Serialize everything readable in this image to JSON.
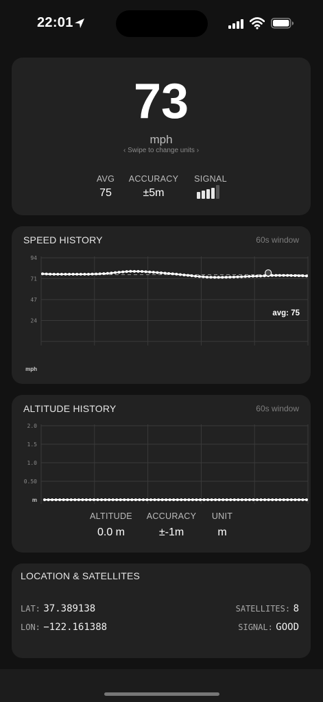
{
  "status_bar": {
    "time": "22:01"
  },
  "speed": {
    "value": "73",
    "unit": "mph",
    "hint": "‹  Swipe to change units  ›",
    "stats": [
      {
        "label": "AVG",
        "value": "75"
      },
      {
        "label": "ACCURACY",
        "value": "±5m"
      },
      {
        "label": "SIGNAL",
        "value": ""
      }
    ],
    "signal_strength": 4,
    "signal_max": 5
  },
  "speed_history": {
    "title": "SPEED HISTORY",
    "window": "60s window",
    "avg_label": "avg: 75"
  },
  "altitude_history": {
    "title": "ALTITUDE HISTORY",
    "window": "60s window",
    "stats": [
      {
        "label": "ALTITUDE",
        "value": "0.0 m"
      },
      {
        "label": "ACCURACY",
        "value": "±-1m"
      },
      {
        "label": "UNIT",
        "value": "m"
      }
    ]
  },
  "location": {
    "title": "LOCATION & SATELLITES",
    "lat_label": "LAT:",
    "lat_value": "37.389138",
    "lon_label": "LON:",
    "lon_value": "−122.161388",
    "satellites_label": "SATELLITES:",
    "satellites_value": "8",
    "signal_label": "SIGNAL:",
    "signal_value": "GOOD"
  },
  "chart_data": [
    {
      "type": "line",
      "ylabel": "mph",
      "yticks": [
        "94",
        "71",
        "47",
        "24"
      ],
      "ylim": [
        0,
        94
      ],
      "avg": 75,
      "x": [
        0,
        60
      ],
      "series": [
        {
          "values": [
            76,
            75.5,
            75.5,
            75.5,
            75.5,
            75.8,
            76.5,
            77.8,
            78.8,
            78.6,
            77.8,
            76.8,
            75.8,
            74.5,
            73.2,
            72.2,
            72,
            72.2,
            72.6,
            73.2,
            73.6,
            74.2,
            74.2,
            74,
            73.6
          ]
        }
      ],
      "marker_value": 77,
      "grid": true
    },
    {
      "type": "line",
      "ylabel": "m",
      "yticks": [
        "2.0",
        "1.5",
        "1.0",
        "0.50"
      ],
      "ylim": [
        0,
        2.0
      ],
      "series": [
        {
          "values": [
            0,
            0,
            0,
            0,
            0,
            0,
            0,
            0,
            0,
            0,
            0,
            0,
            0,
            0,
            0,
            0,
            0,
            0,
            0,
            0,
            0,
            0,
            0,
            0,
            0
          ]
        }
      ],
      "grid": true
    }
  ]
}
